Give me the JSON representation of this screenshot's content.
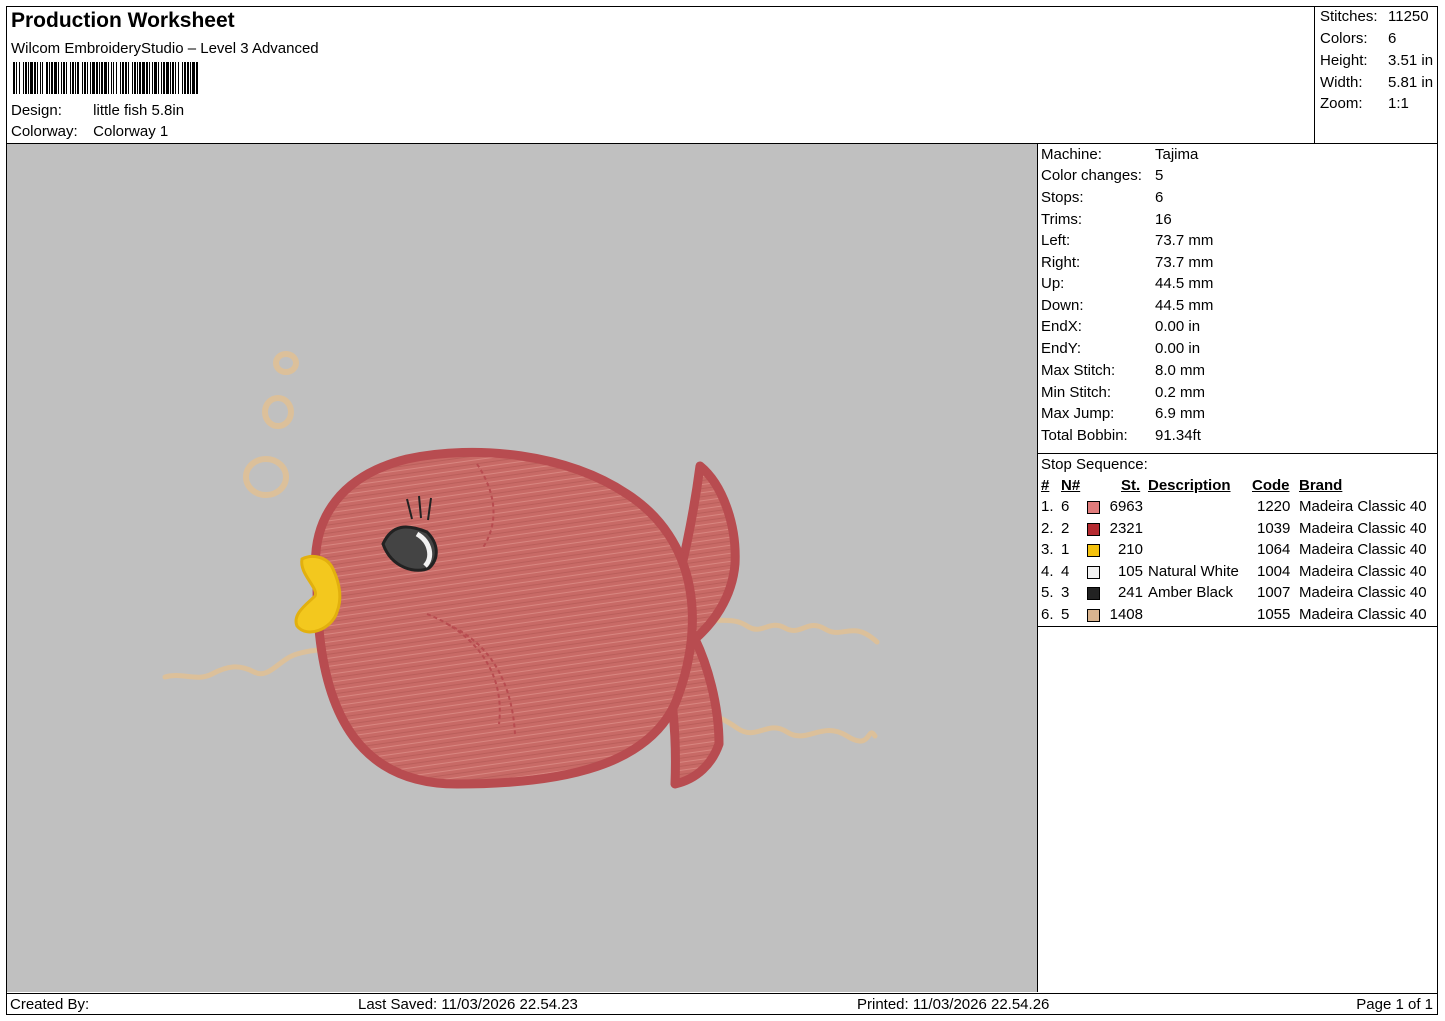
{
  "header": {
    "title": "Production Worksheet",
    "software": "Wilcom EmbroideryStudio – Level 3 Advanced",
    "design_label": "Design:",
    "design_value": "little fish 5.8in",
    "colorway_label": "Colorway:",
    "colorway_value": "Colorway 1"
  },
  "stats": [
    {
      "label": "Stitches:",
      "value": "11250"
    },
    {
      "label": "Colors:",
      "value": "6"
    },
    {
      "label": "Height:",
      "value": "3.51 in"
    },
    {
      "label": "Width:",
      "value": "5.81 in"
    },
    {
      "label": "Zoom:",
      "value": "1:1"
    }
  ],
  "machine_info": [
    {
      "label": "Machine:",
      "value": "Tajima"
    },
    {
      "label": "Color changes:",
      "value": "5"
    },
    {
      "label": "Stops:",
      "value": "6"
    },
    {
      "label": "Trims:",
      "value": "16"
    },
    {
      "label": "Left:",
      "value": "73.7 mm"
    },
    {
      "label": "Right:",
      "value": "73.7 mm"
    },
    {
      "label": "Up:",
      "value": "44.5 mm"
    },
    {
      "label": "Down:",
      "value": "44.5 mm"
    },
    {
      "label": "EndX:",
      "value": "0.00 in"
    },
    {
      "label": "EndY:",
      "value": "0.00 in"
    },
    {
      "label": "Max Stitch:",
      "value": "8.0 mm"
    },
    {
      "label": "Min Stitch:",
      "value": "0.2 mm"
    },
    {
      "label": "Max Jump:",
      "value": "6.9 mm"
    },
    {
      "label": "Total Bobbin:",
      "value": "91.34ft"
    }
  ],
  "stop_sequence": {
    "title": "Stop Sequence:",
    "headers": {
      "num": "#",
      "n": "N#",
      "st": "St.",
      "description": "Description",
      "code": "Code",
      "brand": "Brand"
    },
    "rows": [
      {
        "num": "1.",
        "n": "6",
        "st": "6963",
        "description": "",
        "code": "1220",
        "brand": "Madeira Classic 40",
        "color": "#e07b7b"
      },
      {
        "num": "2.",
        "n": "2",
        "st": "2321",
        "description": "",
        "code": "1039",
        "brand": "Madeira Classic 40",
        "color": "#b52a30"
      },
      {
        "num": "3.",
        "n": "1",
        "st": "210",
        "description": "",
        "code": "1064",
        "brand": "Madeira Classic 40",
        "color": "#f4c20d"
      },
      {
        "num": "4.",
        "n": "4",
        "st": "105",
        "description": "Natural White",
        "code": "1004",
        "brand": "Madeira Classic 40",
        "color": "#f2f2f2"
      },
      {
        "num": "5.",
        "n": "3",
        "st": "241",
        "description": "Amber Black",
        "code": "1007",
        "brand": "Madeira Classic 40",
        "color": "#222222"
      },
      {
        "num": "6.",
        "n": "5",
        "st": "1408",
        "description": "",
        "code": "1055",
        "brand": "Madeira Classic 40",
        "color": "#d9b48f"
      }
    ]
  },
  "footer": {
    "created_by": "Created By:",
    "last_saved": "Last Saved: 11/03/2026 22.54.23",
    "printed": "Printed: 11/03/2026 22.54.26",
    "page": "Page 1 of 1"
  },
  "colors": {
    "body": "#c86a66",
    "outline": "#b84c50",
    "beak": "#f3c81e",
    "thread": "#dcc09a",
    "preview_bg": "#c0c0c0"
  }
}
